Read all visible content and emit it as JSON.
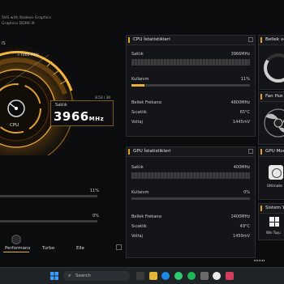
{
  "spec": {
    "line1": "5HS with Radeon Graphics",
    "line2": "Graphics DDR6 i9",
    "line3": "IS"
  },
  "gauge": {
    "max_label": "+7000 MHz",
    "cpu_label": "CPU",
    "readout_label": "Saklık",
    "range": "8.53 / 30",
    "value": "3966",
    "unit": "MHz"
  },
  "left_rows": [
    {
      "value": "11%",
      "fill": 0.11
    },
    {
      "value": "0%",
      "fill": 0.0
    }
  ],
  "modes": {
    "items": [
      "Performans",
      "Turbo",
      "Elle"
    ],
    "active": "Performans"
  },
  "cpu_panel": {
    "title": "CPU İstatistikleri",
    "rows": [
      {
        "label": "Saklık",
        "value": "3966MHz"
      },
      {
        "label": "Kullanım",
        "value": "11%"
      },
      {
        "label": "Bellek Frekansı",
        "value": "4800MHz"
      },
      {
        "label": "Sıcaklık",
        "value": "65°C"
      },
      {
        "label": "Voltaj",
        "value": "1445mV"
      }
    ],
    "usage_fill": 0.11
  },
  "gpu_panel": {
    "title": "GPU İstatistikleri",
    "rows": [
      {
        "label": "Saklık",
        "value": "400MHz"
      },
      {
        "label": "Kullanım",
        "value": "0%"
      },
      {
        "label": "Bellek Frekansı",
        "value": "2400MHz"
      },
      {
        "label": "Sıcaklık",
        "value": "49°C"
      },
      {
        "label": "Voltaj",
        "value": "1459mV"
      }
    ],
    "usage_fill": 0.0
  },
  "right": {
    "memory_title": "Bellek ve",
    "fan_title": "Fan Hızı",
    "gpu_mode_title": "GPU Mod",
    "gpu_mode_label": "Ultimate",
    "system_title": "Sistem Ya",
    "system_label": "Win Tuşu"
  },
  "taskbar": {
    "search_placeholder": "Search"
  },
  "colors": {
    "accent": "#e9b236",
    "panel": "#141518",
    "background": "#0b0c0e"
  }
}
